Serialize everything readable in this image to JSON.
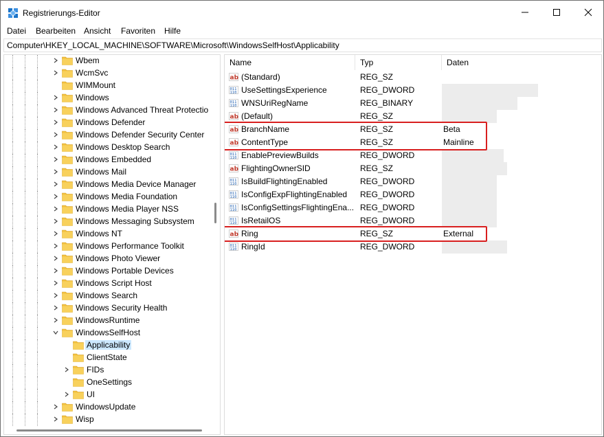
{
  "window": {
    "title": "Registrierungs-Editor",
    "controls": {
      "minimize": "minimize-icon",
      "maximize": "maximize-icon",
      "close": "close-icon"
    }
  },
  "menu": [
    "Datei",
    "Bearbeiten",
    "Ansicht",
    "Favoriten",
    "Hilfe"
  ],
  "address": "Computer\\HKEY_LOCAL_MACHINE\\SOFTWARE\\Microsoft\\WindowsSelfHost\\Applicability",
  "tree": [
    {
      "label": "Wbem",
      "expandable": true
    },
    {
      "label": "WcmSvc",
      "expandable": true
    },
    {
      "label": "WIMMount",
      "expandable": false
    },
    {
      "label": "Windows",
      "expandable": true
    },
    {
      "label": "Windows Advanced Threat Protectio",
      "expandable": true
    },
    {
      "label": "Windows Defender",
      "expandable": true
    },
    {
      "label": "Windows Defender Security Center",
      "expandable": true
    },
    {
      "label": "Windows Desktop Search",
      "expandable": true
    },
    {
      "label": "Windows Embedded",
      "expandable": true
    },
    {
      "label": "Windows Mail",
      "expandable": true
    },
    {
      "label": "Windows Media Device Manager",
      "expandable": true
    },
    {
      "label": "Windows Media Foundation",
      "expandable": true
    },
    {
      "label": "Windows Media Player NSS",
      "expandable": true
    },
    {
      "label": "Windows Messaging Subsystem",
      "expandable": true
    },
    {
      "label": "Windows NT",
      "expandable": true
    },
    {
      "label": "Windows Performance Toolkit",
      "expandable": true
    },
    {
      "label": "Windows Photo Viewer",
      "expandable": true
    },
    {
      "label": "Windows Portable Devices",
      "expandable": true
    },
    {
      "label": "Windows Script Host",
      "expandable": true
    },
    {
      "label": "Windows Search",
      "expandable": true
    },
    {
      "label": "Windows Security Health",
      "expandable": true
    },
    {
      "label": "WindowsRuntime",
      "expandable": true
    },
    {
      "label": "WindowsSelfHost",
      "expandable": true,
      "expanded": true
    },
    {
      "label": "Applicability",
      "expandable": false,
      "child": true,
      "selected": true
    },
    {
      "label": "ClientState",
      "expandable": false,
      "child": true
    },
    {
      "label": "FIDs",
      "expandable": true,
      "child": true
    },
    {
      "label": "OneSettings",
      "expandable": false,
      "child": true
    },
    {
      "label": "UI",
      "expandable": true,
      "child": true
    },
    {
      "label": "WindowsUpdate",
      "expandable": true
    },
    {
      "label": "Wisp",
      "expandable": true
    }
  ],
  "columns": [
    "Name",
    "Typ",
    "Daten"
  ],
  "values": [
    {
      "name": "(Standard)",
      "type": "REG_SZ",
      "data": "",
      "icon": "ab"
    },
    {
      "name": "UseSettingsExperience",
      "type": "REG_DWORD",
      "data": "",
      "icon": "bin"
    },
    {
      "name": "WNSUriRegName",
      "type": "REG_BINARY",
      "data": "",
      "icon": "bin"
    },
    {
      "name": "(Default)",
      "type": "REG_SZ",
      "data": "",
      "icon": "ab"
    },
    {
      "name": "BranchName",
      "type": "REG_SZ",
      "data": "Beta",
      "icon": "ab"
    },
    {
      "name": "ContentType",
      "type": "REG_SZ",
      "data": "Mainline",
      "icon": "ab"
    },
    {
      "name": "EnablePreviewBuilds",
      "type": "REG_DWORD",
      "data": "",
      "icon": "bin"
    },
    {
      "name": "FlightingOwnerSID",
      "type": "REG_SZ",
      "data": "",
      "icon": "ab"
    },
    {
      "name": "IsBuildFlightingEnabled",
      "type": "REG_DWORD",
      "data": "",
      "icon": "bin"
    },
    {
      "name": "IsConfigExpFlightingEnabled",
      "type": "REG_DWORD",
      "data": "",
      "icon": "bin"
    },
    {
      "name": "IsConfigSettingsFlightingEna...",
      "type": "REG_DWORD",
      "data": "",
      "icon": "bin"
    },
    {
      "name": "IsRetailOS",
      "type": "REG_DWORD",
      "data": "",
      "icon": "bin"
    },
    {
      "name": "Ring",
      "type": "REG_SZ",
      "data": "External",
      "icon": "ab"
    },
    {
      "name": "RingId",
      "type": "REG_DWORD",
      "data": "",
      "icon": "bin"
    }
  ],
  "colors": {
    "highlight": "#d81e1e",
    "selection": "#cce8ff",
    "folder": "#f3c240"
  }
}
